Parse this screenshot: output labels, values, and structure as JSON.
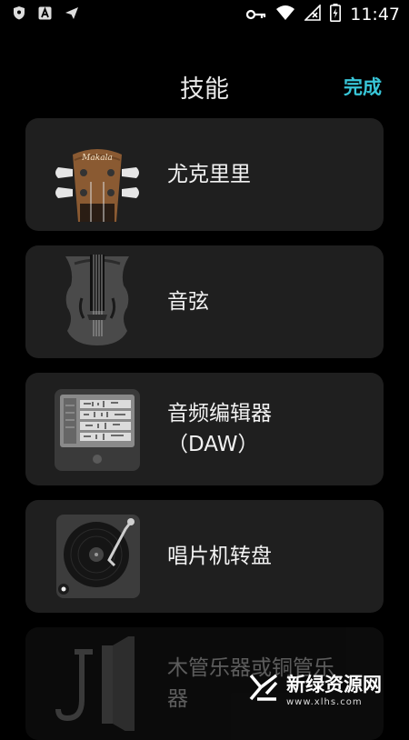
{
  "status": {
    "time": "11:47",
    "left_icons": [
      "shield-icon",
      "a-badge-icon",
      "send-icon"
    ],
    "right_icons": [
      "key-icon",
      "wifi-icon",
      "signal-icon",
      "battery-charging-icon"
    ]
  },
  "header": {
    "title": "技能",
    "done_label": "完成"
  },
  "skills": [
    {
      "label": "尤克里里",
      "icon": "ukulele-icon"
    },
    {
      "label": "音弦",
      "icon": "violin-icon"
    },
    {
      "label_line1": "音频编辑器",
      "label_line2": "（DAW）",
      "icon": "daw-icon"
    },
    {
      "label": "唱片机转盘",
      "icon": "turntable-icon"
    },
    {
      "label_line1": "木管乐器或铜管乐",
      "label_line2": "器",
      "icon": "wind-instrument-icon"
    }
  ],
  "watermark": {
    "text": "新绿资源网",
    "sub": "www.xlhs.com"
  },
  "colors": {
    "accent": "#38c6d8",
    "card": "#1f1f1f",
    "background": "#000000"
  }
}
